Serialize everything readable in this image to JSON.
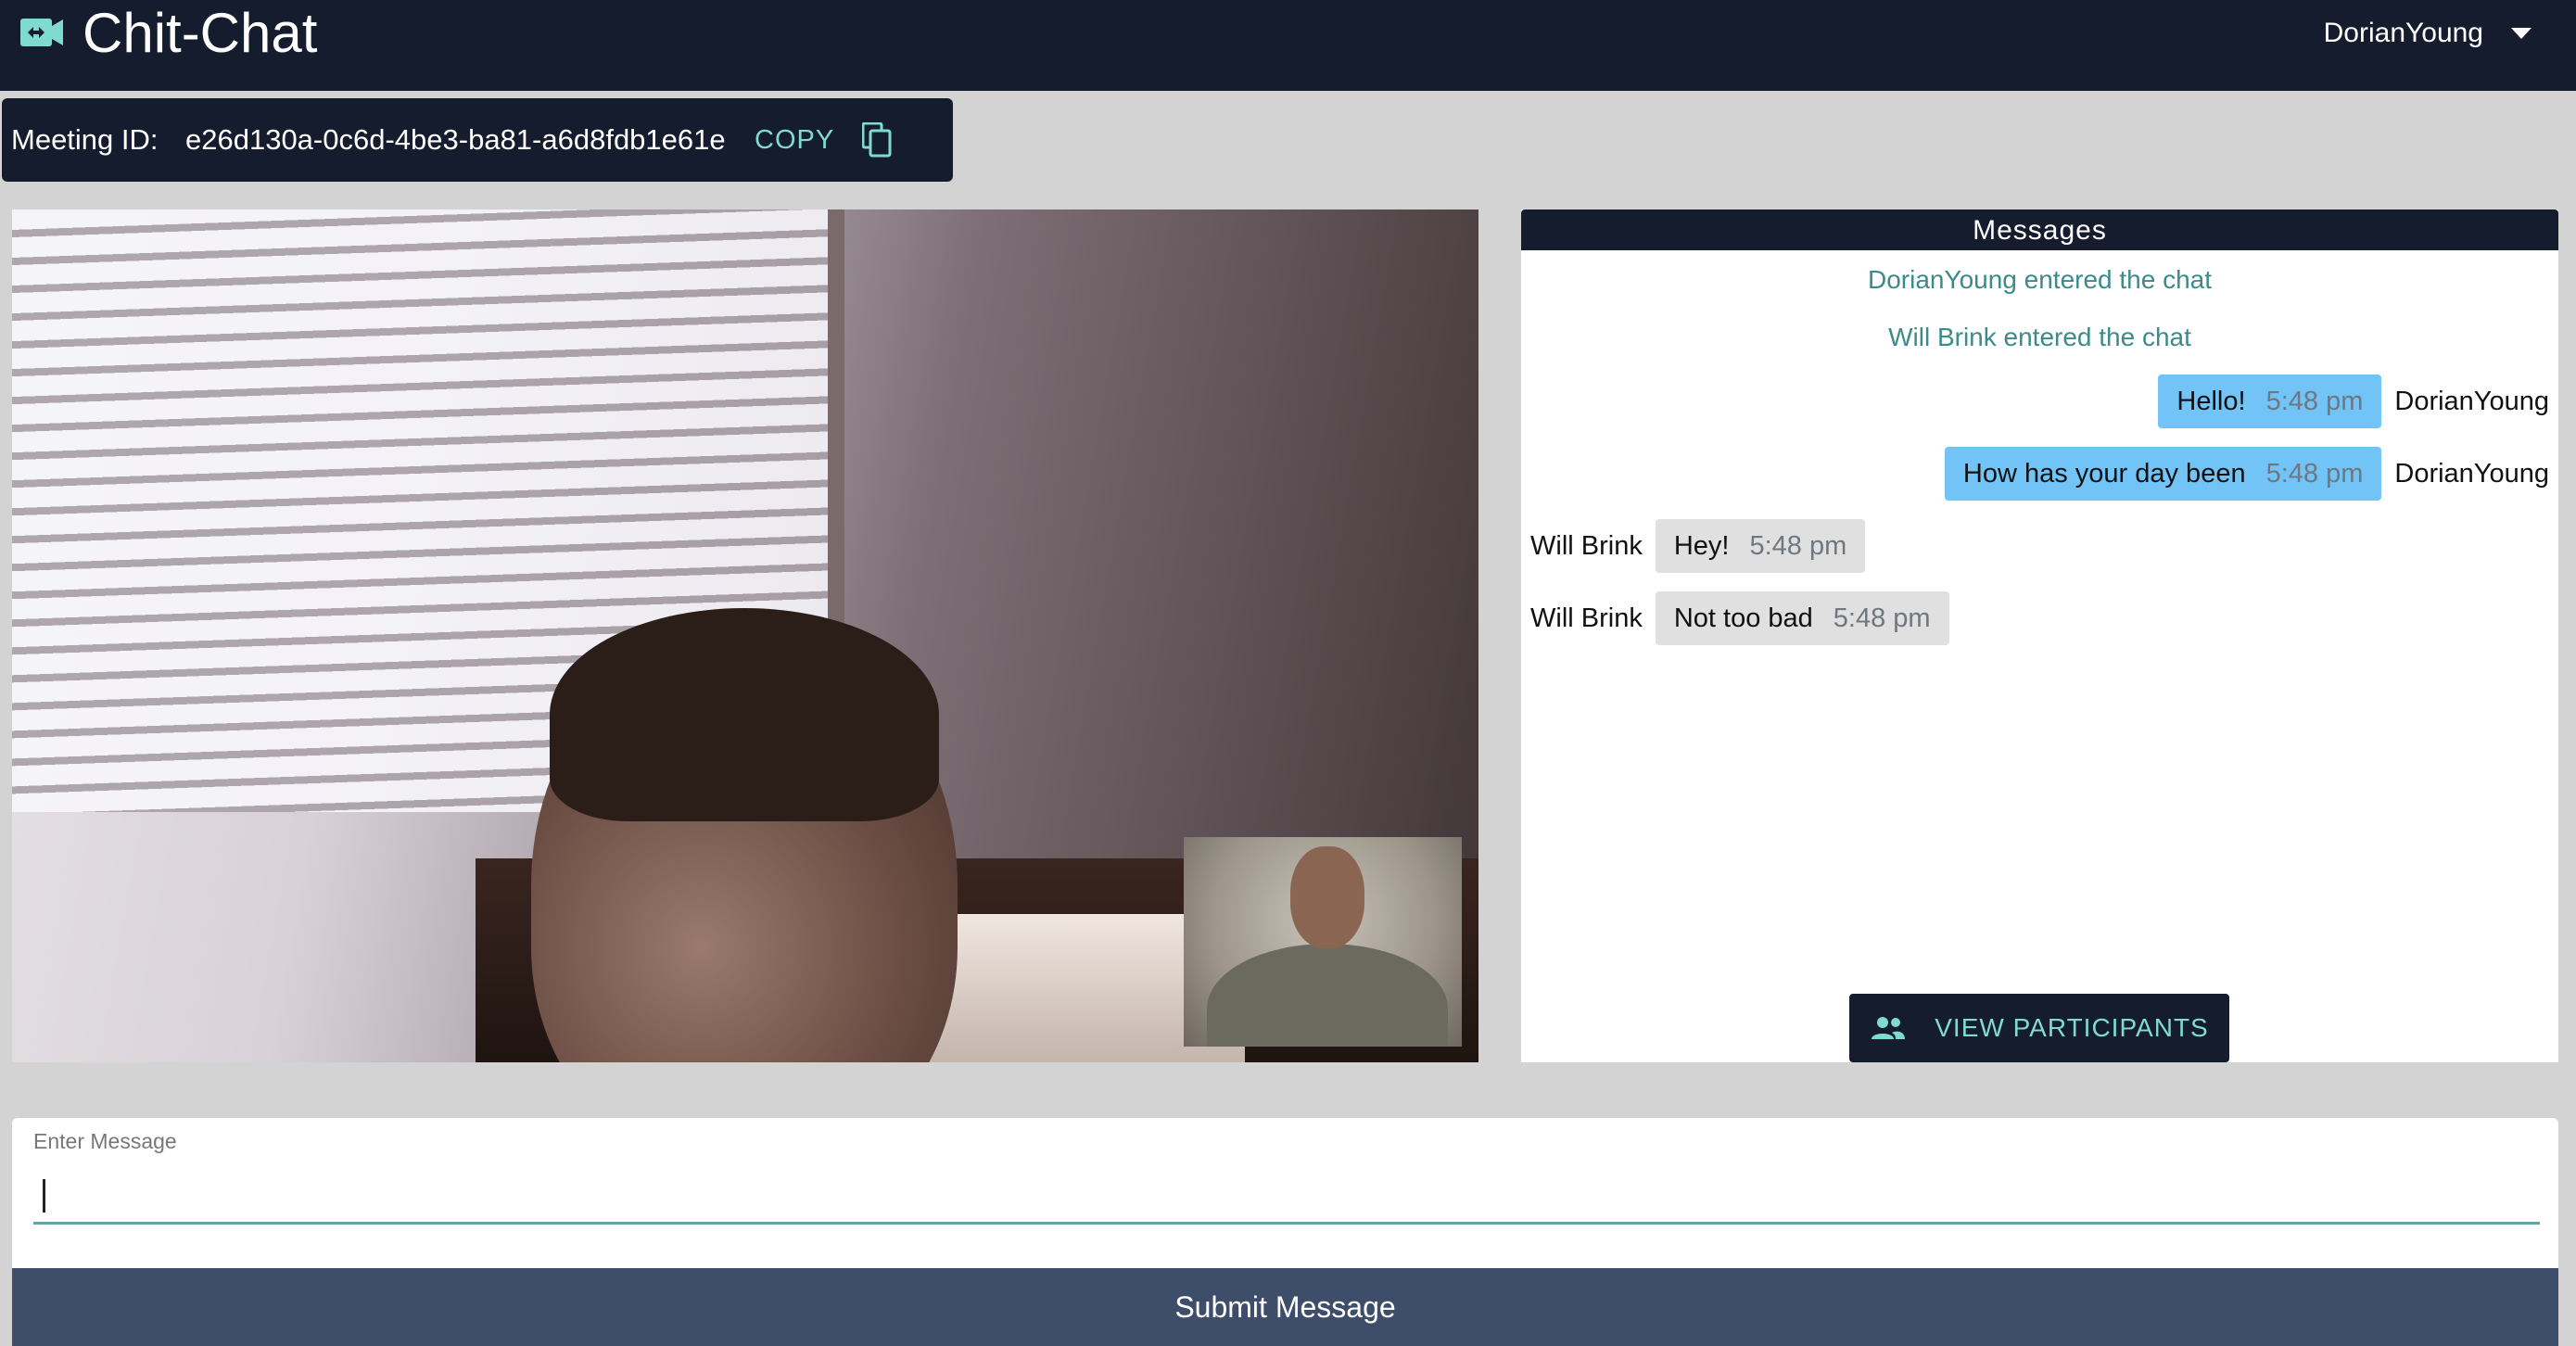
{
  "app": {
    "title": "Chit-Chat",
    "user": "DorianYoung"
  },
  "meeting": {
    "label": "Meeting ID:",
    "id": "e26d130a-0c6d-4be3-ba81-a6d8fdb1e61e",
    "copy_label": "COPY"
  },
  "messages": {
    "header": "Messages",
    "system": [
      "DorianYoung entered the chat",
      "Will Brink entered the chat"
    ],
    "chat": [
      {
        "author": "DorianYoung",
        "text": "Hello!",
        "time": "5:48 pm",
        "mine": true
      },
      {
        "author": "DorianYoung",
        "text": "How has your day been",
        "time": "5:48 pm",
        "mine": true
      },
      {
        "author": "Will Brink",
        "text": "Hey!",
        "time": "5:48 pm",
        "mine": false
      },
      {
        "author": "Will Brink",
        "text": "Not too bad",
        "time": "5:48 pm",
        "mine": false
      }
    ],
    "view_participants_label": "VIEW PARTICIPANTS"
  },
  "composer": {
    "label": "Enter Message",
    "value": "",
    "submit_label": "Submit Message"
  },
  "icons": {
    "logo": "video-call-icon",
    "copy": "copy-icon",
    "participants": "people-icon",
    "menu": "caret-down-icon"
  },
  "colors": {
    "appbar": "#141c2e",
    "accent": "#7fdbd0",
    "my_bubble": "#72c3f6",
    "their_bubble": "#e0e0e0",
    "system_text": "#3d8a8a",
    "submit": "#3e4e6a"
  }
}
